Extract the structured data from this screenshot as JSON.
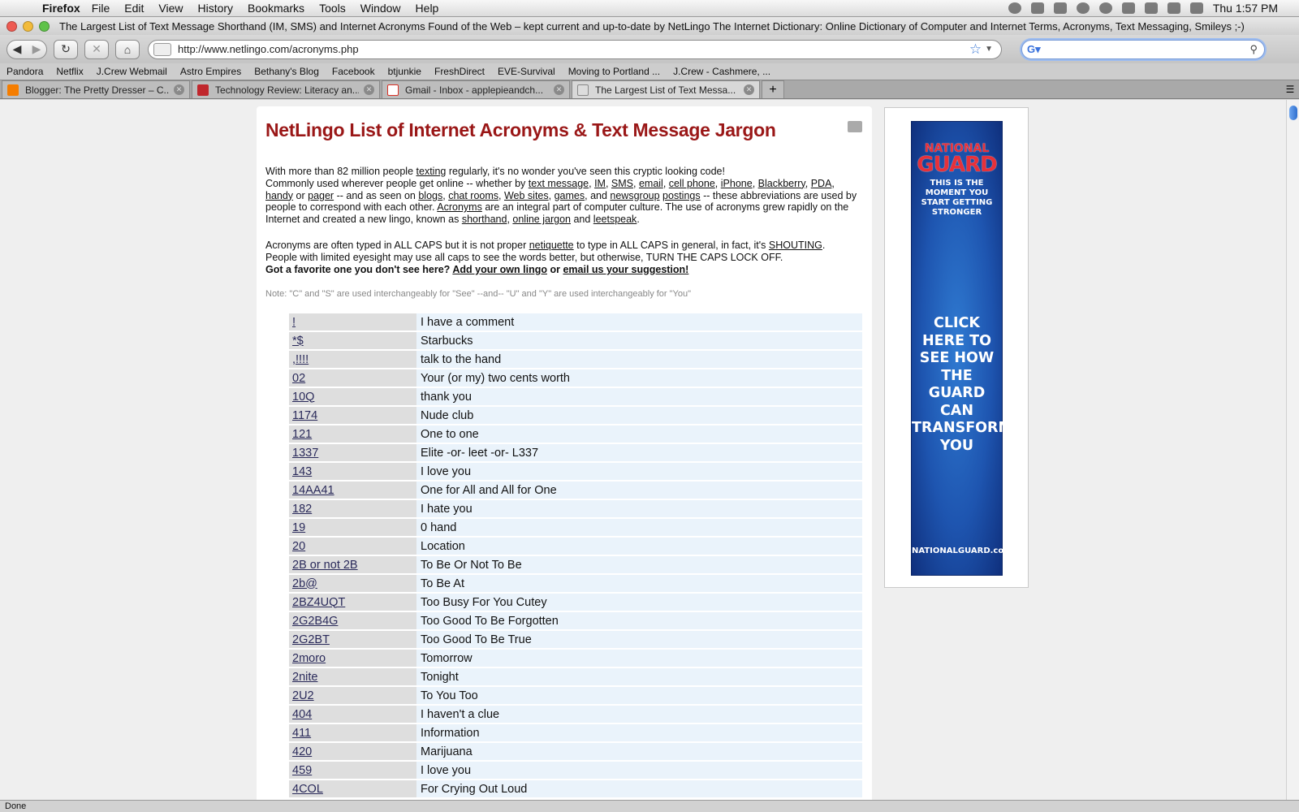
{
  "menubar": {
    "app": "Firefox",
    "items": [
      "File",
      "Edit",
      "View",
      "History",
      "Bookmarks",
      "Tools",
      "Window",
      "Help"
    ],
    "clock": "Thu 1:57 PM"
  },
  "window": {
    "title": "The Largest List of Text Message Shorthand (IM, SMS) and Internet Acronyms Found of the Web – kept current and up-to-date by NetLingo The Internet Dictionary: Online Dictionary of Computer and Internet Terms, Acronyms, Text Messaging, Smileys ;-)"
  },
  "toolbar": {
    "url": "http://www.netlingo.com/acronyms.php",
    "search_value": ""
  },
  "bookmarks": [
    "Pandora",
    "Netflix",
    "J.Crew Webmail",
    "Astro Empires",
    "Bethany's Blog",
    "Facebook",
    "btjunkie",
    "FreshDirect",
    "EVE-Survival",
    "Moving to Portland ...",
    "J.Crew - Cashmere, ..."
  ],
  "tabs": [
    {
      "label": "Blogger: The Pretty Dresser – C...",
      "icon": "blogger-icon",
      "color": "#f57d00"
    },
    {
      "label": "Technology Review: Literacy an...",
      "icon": "tr-icon",
      "color": "#c0272d"
    },
    {
      "label": "Gmail - Inbox - applepieandch...",
      "icon": "gmail-icon",
      "color": "#d93025"
    },
    {
      "label": "The Largest List of Text Messa...",
      "icon": "netlingo-icon",
      "color": "#888888"
    }
  ],
  "page": {
    "heading": "NetLingo List of Internet Acronyms & Text Message Jargon",
    "intro": {
      "t1": "With more than 82 million people ",
      "l_texting": "texting",
      "t2": " regularly, it's no wonder you've seen this cryptic looking code!",
      "t3": "Commonly used wherever people get online -- whether by ",
      "l_textmessage": "text message",
      "l_im": "IM",
      "l_sms": "SMS",
      "l_email": "email",
      "l_cellphone": "cell phone",
      "l_iphone": "iPhone",
      "l_blackberry": "Blackberry",
      "l_pda": "PDA",
      "l_handy": "handy",
      "t_or": " or ",
      "l_pager": "pager",
      "t4": " -- and as seen on ",
      "l_blogs": "blogs",
      "l_chatrooms": "chat rooms",
      "l_websites": "Web sites",
      "l_games": "games",
      "t_and": ", and ",
      "l_newsgroup": "newsgroup",
      "l_postings": "postings",
      "t5": " -- these abbreviations are used by people to correspond with each other. ",
      "l_acronyms": "Acronyms",
      "t6": " are an integral part of computer culture. The use of acronyms grew rapidly on the Internet and created a new lingo, known as ",
      "l_shorthand": "shorthand",
      "l_onlinejargon": "online jargon",
      "t_and2": " and ",
      "l_leetspeak": "leetspeak"
    },
    "caps": {
      "t1": "Acronyms are often typed in ALL CAPS but it is not proper ",
      "l_netiquette": "netiquette",
      "t2": " to type in ALL CAPS in general, in fact, it's ",
      "l_shouting": "SHOUTING",
      "t3": "People with limited eyesight may use all caps to see the words better, but otherwise, TURN THE CAPS LOCK OFF.",
      "t4": "Got a favorite one you don't see here? ",
      "l_add": "Add your own lingo",
      "t_or": " or ",
      "l_email": "email us your suggestion!"
    },
    "note": "Note: \"C\" and \"S\" are used interchangeably for \"See\" --and-- \"U\" and \"Y\" are used interchangeably for \"You\"",
    "acronyms": [
      {
        "term": "!",
        "meaning": "I have a comment"
      },
      {
        "term": "*$",
        "meaning": "Starbucks"
      },
      {
        "term": ",!!!!",
        "meaning": "talk to the hand"
      },
      {
        "term": "02",
        "meaning": "Your (or my) two cents worth"
      },
      {
        "term": "10Q",
        "meaning": "thank you"
      },
      {
        "term": "1174",
        "meaning": "Nude club"
      },
      {
        "term": "121",
        "meaning": "One to one"
      },
      {
        "term": "1337",
        "meaning": "Elite -or- leet -or- L337"
      },
      {
        "term": "143",
        "meaning": "I love you"
      },
      {
        "term": "14AA41",
        "meaning": "One for All and All for One"
      },
      {
        "term": "182",
        "meaning": "I hate you"
      },
      {
        "term": "19",
        "meaning": "0 hand"
      },
      {
        "term": "20",
        "meaning": "Location"
      },
      {
        "term": "2B or not 2B",
        "meaning": "To Be Or Not To Be"
      },
      {
        "term": "2b@",
        "meaning": "To Be At"
      },
      {
        "term": "2BZ4UQT",
        "meaning": "Too Busy For You Cutey"
      },
      {
        "term": "2G2B4G",
        "meaning": "Too Good To Be Forgotten"
      },
      {
        "term": "2G2BT",
        "meaning": "Too Good To Be True"
      },
      {
        "term": "2moro",
        "meaning": "Tomorrow"
      },
      {
        "term": "2nite",
        "meaning": "Tonight"
      },
      {
        "term": "2U2",
        "meaning": "To You Too"
      },
      {
        "term": "404",
        "meaning": "I haven't a clue"
      },
      {
        "term": "411",
        "meaning": "Information"
      },
      {
        "term": "420",
        "meaning": "Marijuana"
      },
      {
        "term": "459",
        "meaning": "I love you"
      },
      {
        "term": "4COL",
        "meaning": "For Crying Out Loud"
      }
    ]
  },
  "ad": {
    "brand_top": "NATIONAL",
    "brand_main": "GUARD",
    "tagline": "THIS IS THE MOMENT YOU START GETTING STRONGER",
    "cta": "CLICK HERE TO SEE HOW THE GUARD CAN TRANSFORM YOU",
    "url": "NATIONALGUARD.com"
  },
  "status": "Done"
}
